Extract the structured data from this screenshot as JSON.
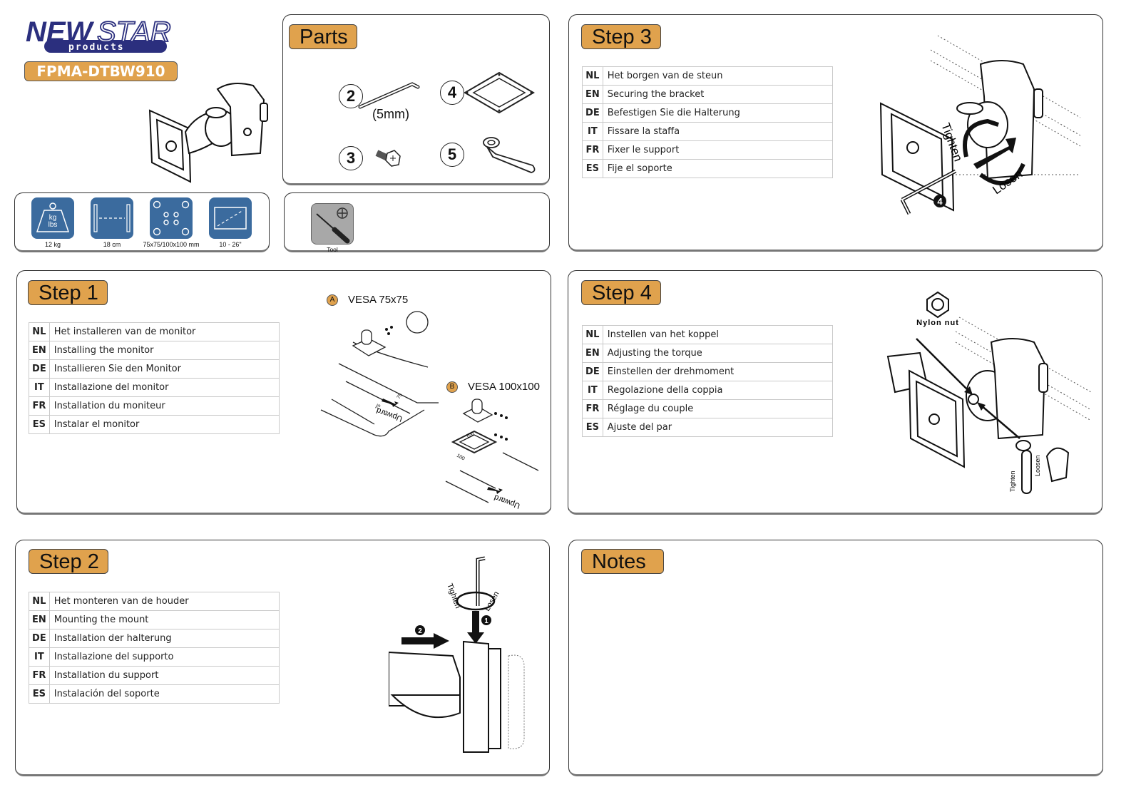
{
  "brand": {
    "logo_main": "NEW",
    "logo_accent": "STAR",
    "logo_sub": "products",
    "model": "FPMA-DTBW910",
    "colors": {
      "navy": "#2b2f7e",
      "orange": "#e0a24d",
      "spec_blue": "#3b6b9e",
      "tool_gray": "#a8a8a8"
    }
  },
  "specs": [
    {
      "icon": "weight-icon",
      "label": "12 kg",
      "icon_text": [
        "kg",
        "lbs"
      ]
    },
    {
      "icon": "distance-icon",
      "label": "18 cm"
    },
    {
      "icon": "vesa-holes-icon",
      "label": "75x75/100x100 mm"
    },
    {
      "icon": "screen-size-icon",
      "label": "10 - 26\""
    }
  ],
  "parts": {
    "title": "Parts",
    "items": [
      {
        "number": "2",
        "name": "allen-key",
        "note": "(5mm)"
      },
      {
        "number": "3",
        "name": "screw"
      },
      {
        "number": "4",
        "name": "vesa-adapter-plate"
      },
      {
        "number": "5",
        "name": "wrench"
      }
    ]
  },
  "tools": {
    "label": "Tool",
    "icon": "phillips-screwdriver-icon"
  },
  "steps": [
    {
      "title": "Step 1",
      "rows": [
        {
          "code": "NL",
          "text": "Het installeren van de monitor"
        },
        {
          "code": "EN",
          "text": "Installing the monitor"
        },
        {
          "code": "DE",
          "text": "Installieren Sie den Monitor"
        },
        {
          "code": "IT",
          "text": "Installazione del monitor"
        },
        {
          "code": "FR",
          "text": "Installation du moniteur"
        },
        {
          "code": "ES",
          "text": "Instalar el monitor"
        }
      ],
      "diagram": {
        "option_a": {
          "marker": "A",
          "label": "VESA 75x75",
          "dims": [
            "75",
            "75"
          ]
        },
        "option_b": {
          "marker": "B",
          "label": "VESA 100x100",
          "dims": [
            "100",
            "100"
          ]
        },
        "orientation": "Upward"
      }
    },
    {
      "title": "Step 2",
      "rows": [
        {
          "code": "NL",
          "text": "Het monteren van de houder"
        },
        {
          "code": "EN",
          "text": "Mounting the mount"
        },
        {
          "code": "DE",
          "text": "Installation der halterung"
        },
        {
          "code": "IT",
          "text": "Installazione del supporto"
        },
        {
          "code": "FR",
          "text": "Installation du support"
        },
        {
          "code": "ES",
          "text": "Instalación del soporte"
        }
      ],
      "diagram": {
        "tighten": "Tighten",
        "loosen": "Losen",
        "markers": [
          "1",
          "2"
        ]
      }
    },
    {
      "title": "Step 3",
      "rows": [
        {
          "code": "NL",
          "text": "Het borgen van de steun"
        },
        {
          "code": "EN",
          "text": "Securing the bracket"
        },
        {
          "code": "DE",
          "text": "Befestigen Sie die Halterung"
        },
        {
          "code": "IT",
          "text": "Fissare la staffa"
        },
        {
          "code": "FR",
          "text": "Fixer le support"
        },
        {
          "code": "ES",
          "text": "Fije el soporte"
        }
      ],
      "diagram": {
        "tighten": "Tighten",
        "loosen": "Losen",
        "marker": "4"
      }
    },
    {
      "title": "Step 4",
      "rows": [
        {
          "code": "NL",
          "text": "Instellen van het koppel"
        },
        {
          "code": "EN",
          "text": "Adjusting the torque"
        },
        {
          "code": "DE",
          "text": "Einstellen der drehmoment"
        },
        {
          "code": "IT",
          "text": "Regolazione della coppia"
        },
        {
          "code": "FR",
          "text": "Réglage du couple"
        },
        {
          "code": "ES",
          "text": "Ajuste del par"
        }
      ],
      "diagram": {
        "callout": "Nylon nut",
        "tighten": "Tighten",
        "loosen": "Loosen"
      }
    }
  ],
  "notes": {
    "title": "Notes"
  }
}
